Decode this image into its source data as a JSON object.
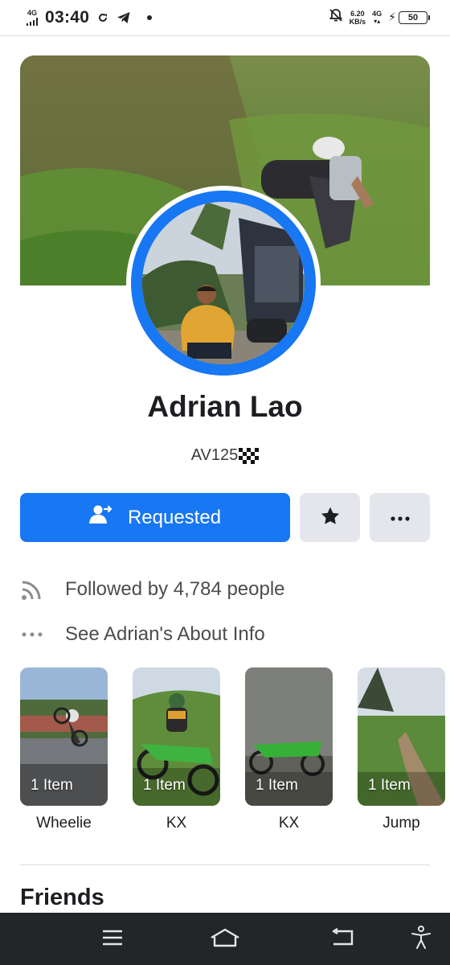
{
  "status_bar": {
    "network_left": "4G",
    "time": "03:40",
    "net_speed": "6.20",
    "net_speed_unit": "KB/s",
    "network_right": "4G",
    "battery": "50"
  },
  "profile": {
    "name": "Adrian Lao",
    "bio": "AV125"
  },
  "actions": {
    "primary_label": "Requested",
    "favorite_icon": "star-icon",
    "more_icon": "more-icon"
  },
  "info": {
    "followed_by": "Followed by 4,784 people",
    "about": "See Adrian's About Info"
  },
  "featured": [
    {
      "count": "1 Item",
      "title": "Wheelie"
    },
    {
      "count": "1 Item",
      "title": "KX"
    },
    {
      "count": "1 Item",
      "title": "KX"
    },
    {
      "count": "1 Item",
      "title": "Jump"
    }
  ],
  "sections": {
    "friends_title": "Friends"
  },
  "colors": {
    "accent": "#1877f2",
    "secondary_button": "#e4e6eb",
    "nav_bar": "#242526"
  }
}
